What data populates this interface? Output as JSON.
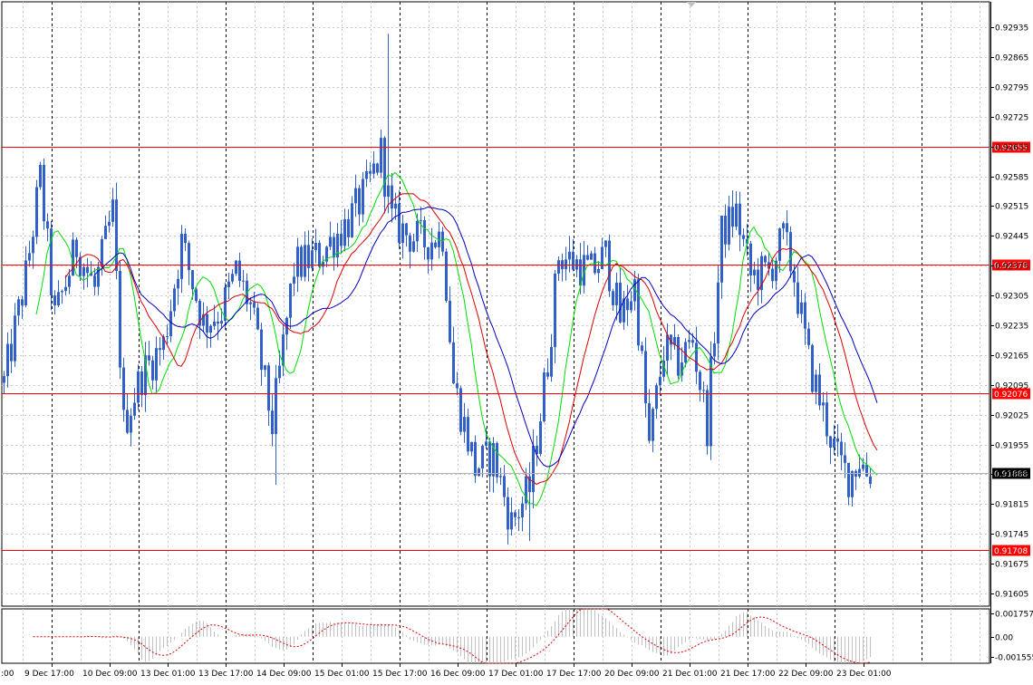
{
  "chart_data": {
    "type": "candlestick",
    "price_axis": {
      "ylim": [
        0.91575,
        0.92995
      ],
      "ticks": [
        "0.92935",
        "0.92865",
        "0.92795",
        "0.92725",
        "0.92655",
        "0.92585",
        "0.92515",
        "0.92445",
        "0.92375",
        "0.92305",
        "0.92235",
        "0.92165",
        "0.92095",
        "0.92025",
        "0.91955",
        "0.91885",
        "0.91815",
        "0.91745",
        "0.91675",
        "0.91605"
      ]
    },
    "time_axis": {
      "labels": [
        ":00",
        "9 Dec 17:00",
        "10 Dec 09:00",
        "13 Dec 01:00",
        "13 Dec 17:00",
        "14 Dec 09:00",
        "15 Dec 01:00",
        "15 Dec 17:00",
        "16 Dec 09:00",
        "17 Dec 01:00",
        "17 Dec 17:00",
        "20 Dec 09:00",
        "21 Dec 01:00",
        "21 Dec 17:00",
        "22 Dec 09:00",
        "23 Dec 01:00"
      ],
      "bars_visible": 240
    },
    "horizontal_levels": [
      {
        "price": "0.92655",
        "color": "#ff0000"
      },
      {
        "price": "0.92378",
        "color": "#ff0000"
      },
      {
        "price": "0.92076",
        "color": "#ff0000"
      },
      {
        "price": "0.91708",
        "color": "#ff0000"
      }
    ],
    "current_price": {
      "price": "0.91888",
      "color": "#000000"
    },
    "price_anchors": [
      [
        0,
        0.921
      ],
      [
        6,
        0.9235
      ],
      [
        10,
        0.9258
      ],
      [
        14,
        0.9225
      ],
      [
        20,
        0.9242
      ],
      [
        25,
        0.9232
      ],
      [
        30,
        0.925
      ],
      [
        33,
        0.92
      ],
      [
        38,
        0.9212
      ],
      [
        44,
        0.9219
      ],
      [
        49,
        0.9243
      ],
      [
        55,
        0.9224
      ],
      [
        60,
        0.9227
      ],
      [
        64,
        0.9236
      ],
      [
        68,
        0.9228
      ],
      [
        74,
        0.92
      ],
      [
        80,
        0.9237
      ],
      [
        87,
        0.924
      ],
      [
        95,
        0.9248
      ],
      [
        100,
        0.9255
      ],
      [
        104,
        0.9264
      ],
      [
        107,
        0.9248
      ],
      [
        111,
        0.9245
      ],
      [
        116,
        0.9243
      ],
      [
        121,
        0.9245
      ],
      [
        124,
        0.921
      ],
      [
        130,
        0.919
      ],
      [
        135,
        0.9193
      ],
      [
        140,
        0.9177
      ],
      [
        145,
        0.9185
      ],
      [
        150,
        0.9215
      ],
      [
        153,
        0.924
      ],
      [
        158,
        0.9238
      ],
      [
        162,
        0.9236
      ],
      [
        166,
        0.924
      ],
      [
        170,
        0.9225
      ],
      [
        174,
        0.9233
      ],
      [
        178,
        0.9195
      ],
      [
        182,
        0.9218
      ],
      [
        186,
        0.9215
      ],
      [
        190,
        0.922
      ],
      [
        194,
        0.92
      ],
      [
        198,
        0.9245
      ],
      [
        202,
        0.925
      ],
      [
        206,
        0.9235
      ],
      [
        211,
        0.9236
      ],
      [
        215,
        0.9244
      ],
      [
        218,
        0.9235
      ],
      [
        222,
        0.9215
      ],
      [
        226,
        0.9203
      ],
      [
        230,
        0.9192
      ],
      [
        233,
        0.9188
      ],
      [
        236,
        0.9192
      ],
      [
        238,
        0.9189
      ]
    ],
    "moving_averages": [
      {
        "period": 8,
        "color": "#00dd00"
      },
      {
        "period": 16,
        "color": "#dd0000"
      },
      {
        "period": 24,
        "color": "#0000c0"
      }
    ],
    "candle_color": "#3060c8",
    "oscillator": {
      "ticks": [
        "0.001757",
        "0.00",
        "-0.001555"
      ],
      "ylim": [
        -0.002,
        0.0021
      ],
      "histogram_color": "#c0c0c0",
      "signal_color": "#dd0000"
    },
    "grid": true
  }
}
